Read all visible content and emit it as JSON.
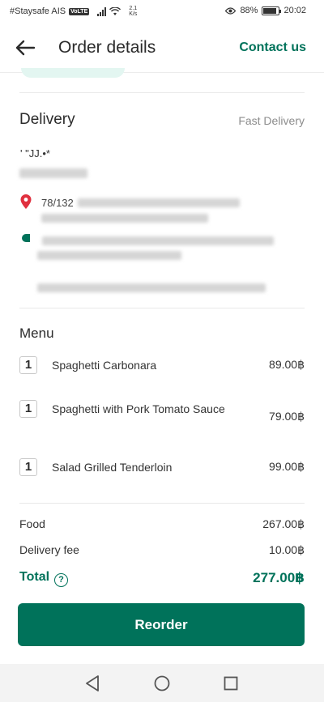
{
  "status_bar": {
    "carrier": "#Staysafe AIS",
    "network_badge": "VoLTE",
    "speed_value": "2.1",
    "speed_unit": "K/s",
    "battery": "88%",
    "time": "20:02"
  },
  "header": {
    "title": "Order details",
    "contact_label": "Contact us"
  },
  "delivery": {
    "title": "Delivery",
    "type": "Fast Delivery",
    "recipient_partial": "' \"JJ.•*",
    "address_partial": "78/132"
  },
  "menu": {
    "title": "Menu",
    "items": [
      {
        "qty": "1",
        "name": "Spaghetti Carbonara",
        "price": "89.00฿"
      },
      {
        "qty": "1",
        "name": "Spaghetti with Pork Tomato Sauce",
        "price": "79.00฿"
      },
      {
        "qty": "1",
        "name": "Salad Grilled Tenderloin",
        "price": "99.00฿"
      }
    ]
  },
  "summary": {
    "food_label": "Food",
    "food_value": "267.00฿",
    "delivery_fee_label": "Delivery fee",
    "delivery_fee_value": "10.00฿",
    "total_label": "Total",
    "total_value": "277.00฿"
  },
  "actions": {
    "reorder_label": "Reorder"
  },
  "colors": {
    "brand_green": "#00725a",
    "pin_red": "#e0303f"
  },
  "icons": {
    "back": "arrow-left",
    "info": "question-circle",
    "pin": "map-pin",
    "nav": [
      "triangle-back",
      "circle-home",
      "square-recents"
    ]
  }
}
